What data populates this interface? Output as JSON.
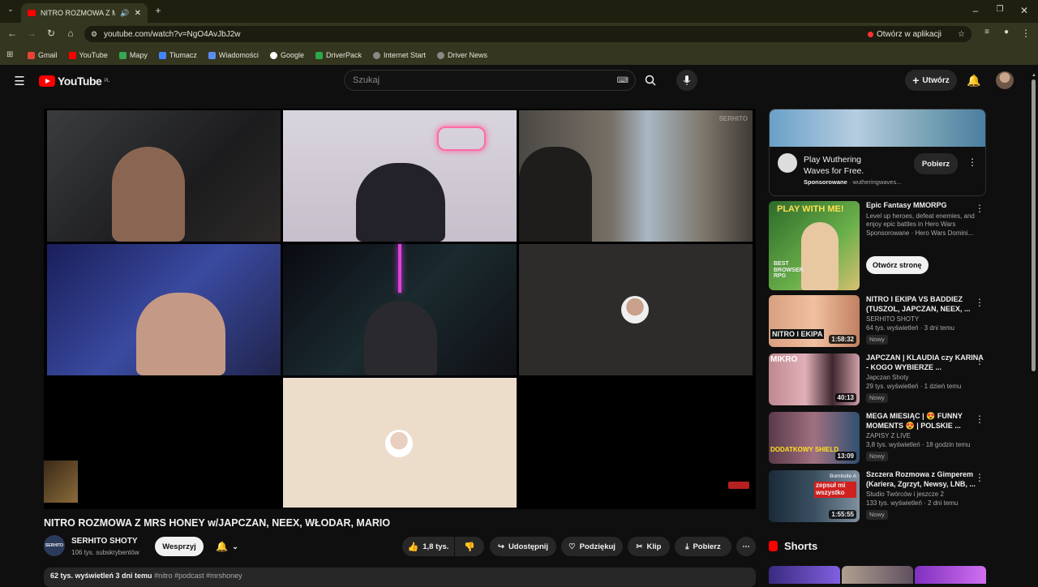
{
  "browser": {
    "tab_title": "NITRO ROZMOWA Z MRS H",
    "url": "youtube.com/watch?v=NgO4AvJbJ2w",
    "open_in_app": "Otwórz w aplikacji",
    "bookmarks": [
      "Gmail",
      "YouTube",
      "Mapy",
      "Tłumacz",
      "Wiadomości",
      "Google",
      "DriverPack",
      "Internet Start",
      "Driver News"
    ]
  },
  "header": {
    "logo": "YouTube",
    "region": "PL",
    "search_placeholder": "Szukaj",
    "create_label": "Utwórz"
  },
  "video": {
    "watermark": "SERHITO",
    "title": "NITRO ROZMOWA Z MRS HONEY w/JAPCZAN, NEEX, WŁODAR, MARIO",
    "channel": "SERHITO SHOTY",
    "channel_avatar_text": "SERHITO",
    "subscribers": "106 tys. subskrybentów",
    "support_label": "Wesprzyj",
    "likes": "1,8 tys.",
    "share": "Udostępnij",
    "thanks": "Podziękuj",
    "clip": "Klip",
    "download": "Pobierz",
    "views_date": "62 tys. wyświetleń  3 dni temu",
    "tags": "#nitro #podcast #mrshoney"
  },
  "ad": {
    "title": "Play Wuthering Waves for Free.",
    "sponsored": "Sponsorowane",
    "domain": "wutheringwaves...",
    "button": "Pobierz"
  },
  "recommendations": [
    {
      "title": "Epic Fantasy MMORPG",
      "line1": "Level up heroes, defeat enemies, and enjoy epic battles in Hero Wars",
      "line2": "Sponsorowane · Hero Wars Domini...",
      "button": "Otwórz stronę",
      "thumb_text": "PLAY WITH ME!",
      "thumb_text2": "BEST BROWSER RPG"
    },
    {
      "title": "NITRO I EKIPA VS BADDIEZ (TUSZOL, JAPCZAN, NEEX, ...",
      "channel": "SERHITO SHOTY",
      "meta": "64 tys. wyświetleń · 3 dni temu",
      "badge": "Nowy",
      "duration": "1:58:32",
      "thumb_text": "NITRO I EKIPA"
    },
    {
      "title": "JAPCZAN | KLAUDIA czy KARINA - KOGO WYBIERZE ...",
      "channel": "Japczan Shoty",
      "meta": "29 tys. wyświetleń · 1 dzień temu",
      "badge": "Nowy",
      "duration": "40:13",
      "thumb_text": "MIKRO"
    },
    {
      "title": "MEGA MIESIĄC | 😍 FUNNY MOMENTS 😍 | POLSKIE ...",
      "channel": "ZAPISY Z LIVE",
      "meta": "3,8 tys. wyświetleń · 18 godzin temu",
      "badge": "Nowy",
      "duration": "13:09",
      "thumb_text": "DODATKOWY SHIELD"
    },
    {
      "title": "Szczera Rozmowa z Gimperem (Kariera, Zgrzyt, Newsy, LNB, ...",
      "channel": "Studio Twórców i jeszcze 2",
      "meta": "133 tys. wyświetleń · 2 dni temu",
      "badge": "Nowy",
      "duration": "1:55:55",
      "thumb_text": "zepsuł mi wszystko",
      "thumb_text2": "Bombsite A"
    }
  ],
  "shorts_label": "Shorts"
}
